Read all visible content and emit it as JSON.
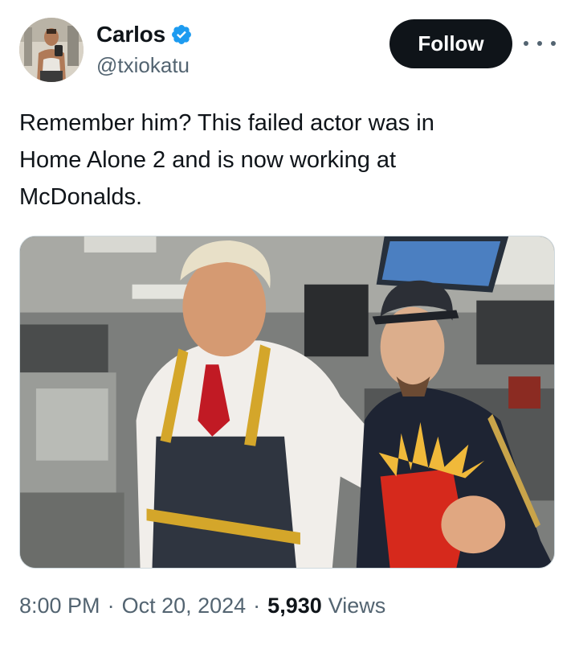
{
  "author": {
    "display_name": "Carlos",
    "handle": "@txiokatu",
    "verified": true,
    "avatar_icon": "profile-photo"
  },
  "actions": {
    "follow_label": "Follow",
    "more_icon": "more-horizontal-icon"
  },
  "tweet": {
    "text": "Remember him? This failed actor was in\nHome Alone 2 and is now working at\nMcDonalds."
  },
  "media": {
    "type": "photo"
  },
  "meta": {
    "time": "8:00 PM",
    "separator": "·",
    "date": "Oct 20, 2024",
    "views_count": "5,930",
    "views_label": "Views"
  },
  "colors": {
    "text_primary": "#0f1419",
    "text_secondary": "#536471",
    "verified_blue": "#1d9bf0",
    "follow_bg": "#0f1419"
  }
}
